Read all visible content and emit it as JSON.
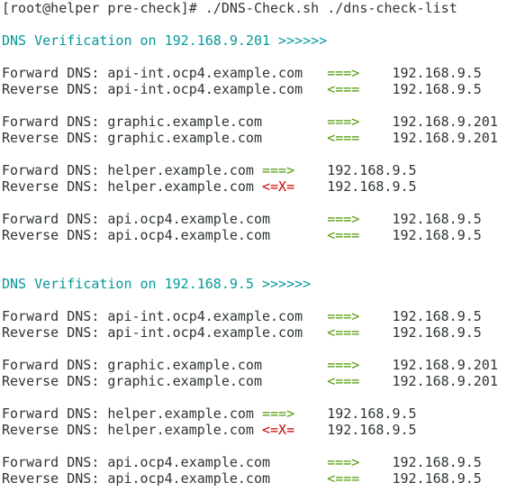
{
  "prompt": "[root@helper pre-check]# ./DNS-Check.sh ./dns-check-list",
  "sections": [
    {
      "header": "DNS Verification on 192.168.9.201 >>>>>>",
      "records": [
        {
          "fwd_label": "Forward DNS: api-int.ocp4.example.com",
          "fwd_arrow": "===>",
          "fwd_ip": "192.168.9.5",
          "rev_label": "Reverse DNS: api-int.ocp4.example.com",
          "rev_arrow": "<===",
          "rev_ip": "192.168.9.5"
        },
        {
          "fwd_label": "Forward DNS: graphic.example.com",
          "fwd_arrow": "===>",
          "fwd_ip": "192.168.9.201",
          "rev_label": "Reverse DNS: graphic.example.com",
          "rev_arrow": "<===",
          "rev_ip": "192.168.9.201"
        },
        {
          "fwd_label": "Forward DNS: helper.example.com",
          "fwd_arrow": "===>",
          "fwd_ip": "192.168.9.5",
          "rev_label": "Reverse DNS: helper.example.com",
          "rev_arrow": "<=X=",
          "rev_ip": "192.168.9.5"
        },
        {
          "fwd_label": "Forward DNS: api.ocp4.example.com",
          "fwd_arrow": "===>",
          "fwd_ip": "192.168.9.5",
          "rev_label": "Reverse DNS: api.ocp4.example.com",
          "rev_arrow": "<===",
          "rev_ip": "192.168.9.5"
        }
      ]
    },
    {
      "header": "DNS Verification on 192.168.9.5 >>>>>>",
      "records": [
        {
          "fwd_label": "Forward DNS: api-int.ocp4.example.com",
          "fwd_arrow": "===>",
          "fwd_ip": "192.168.9.5",
          "rev_label": "Reverse DNS: api-int.ocp4.example.com",
          "rev_arrow": "<===",
          "rev_ip": "192.168.9.5"
        },
        {
          "fwd_label": "Forward DNS: graphic.example.com",
          "fwd_arrow": "===>",
          "fwd_ip": "192.168.9.201",
          "rev_label": "Reverse DNS: graphic.example.com",
          "rev_arrow": "<===",
          "rev_ip": "192.168.9.201"
        },
        {
          "fwd_label": "Forward DNS: helper.example.com",
          "fwd_arrow": "===>",
          "fwd_ip": "192.168.9.5",
          "rev_label": "Reverse DNS: helper.example.com",
          "rev_arrow": "<=X=",
          "rev_ip": "192.168.9.5"
        },
        {
          "fwd_label": "Forward DNS: api.ocp4.example.com",
          "fwd_arrow": "===>",
          "fwd_ip": "192.168.9.5",
          "rev_label": "Reverse DNS: api.ocp4.example.com",
          "rev_arrow": "<===",
          "rev_ip": "192.168.9.5"
        }
      ]
    }
  ],
  "colors": {
    "text": "#2e3436",
    "section_header": "#06989a",
    "arrow_ok": "#4e9a06",
    "arrow_fail": "#cc0000",
    "background": "#ffffff"
  }
}
